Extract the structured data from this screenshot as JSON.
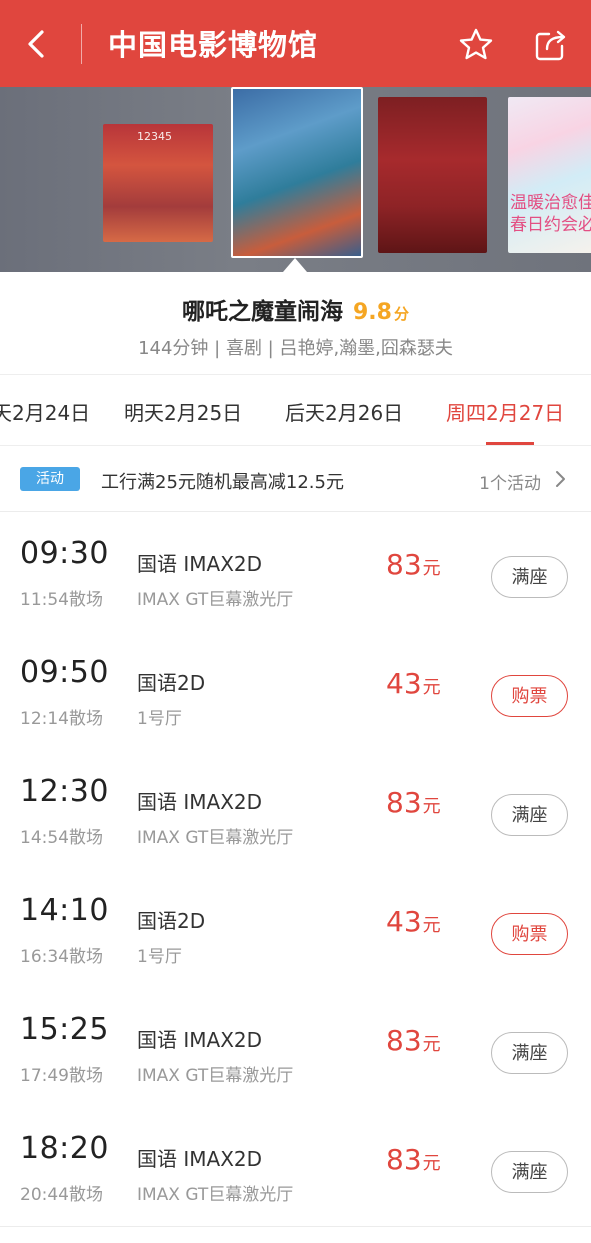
{
  "header": {
    "title": "中国电影博物馆",
    "back_icon": "chevron-left-icon",
    "favorite_icon": "star-icon",
    "share_icon": "share-icon"
  },
  "posters": [
    {
      "name": "poster-1",
      "text": "12345"
    },
    {
      "name": "poster-2-selected",
      "text": ""
    },
    {
      "name": "poster-3",
      "text": ""
    },
    {
      "name": "poster-4",
      "text": "温暖治愈佳\n春日约会必"
    }
  ],
  "movie": {
    "name": "哪吒之魔童闹海",
    "score": "9.8",
    "score_unit": "分",
    "meta": "144分钟 | 喜剧 | 吕艳婷,瀚墨,囧森瑟夫"
  },
  "dates": [
    {
      "label": "天2月24日",
      "active": false
    },
    {
      "label": "明天2月25日",
      "active": false
    },
    {
      "label": "后天2月26日",
      "active": false
    },
    {
      "label": "周四2月27日",
      "active": true
    }
  ],
  "promo": {
    "badge": "活动",
    "text": "工行满25元随机最高减12.5元",
    "count": "1个活动"
  },
  "colors": {
    "accent": "#e0463e",
    "score": "#f5a623",
    "badge": "#4aa6e6"
  },
  "showtimes": [
    {
      "start": "09:30",
      "end": "11:54散场",
      "lang": "国语 IMAX2D",
      "hall": "IMAX GT巨幕激光厅",
      "price": "83",
      "unit": "元",
      "action": "满座",
      "available": false
    },
    {
      "start": "09:50",
      "end": "12:14散场",
      "lang": "国语2D",
      "hall": "1号厅",
      "price": "43",
      "unit": "元",
      "action": "购票",
      "available": true
    },
    {
      "start": "12:30",
      "end": "14:54散场",
      "lang": "国语 IMAX2D",
      "hall": "IMAX GT巨幕激光厅",
      "price": "83",
      "unit": "元",
      "action": "满座",
      "available": false
    },
    {
      "start": "14:10",
      "end": "16:34散场",
      "lang": "国语2D",
      "hall": "1号厅",
      "price": "43",
      "unit": "元",
      "action": "购票",
      "available": true
    },
    {
      "start": "15:25",
      "end": "17:49散场",
      "lang": "国语 IMAX2D",
      "hall": "IMAX GT巨幕激光厅",
      "price": "83",
      "unit": "元",
      "action": "满座",
      "available": false
    },
    {
      "start": "18:20",
      "end": "20:44散场",
      "lang": "国语 IMAX2D",
      "hall": "IMAX GT巨幕激光厅",
      "price": "83",
      "unit": "元",
      "action": "满座",
      "available": false
    }
  ]
}
